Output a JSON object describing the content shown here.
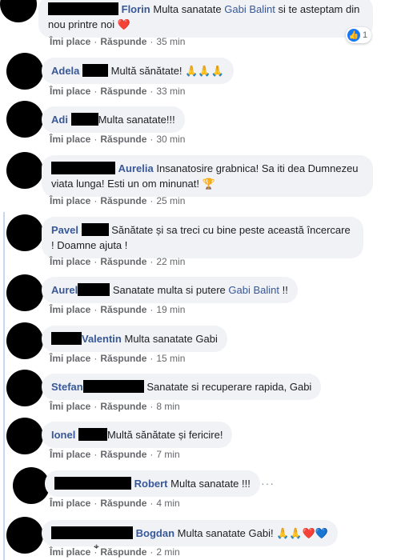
{
  "actions": {
    "like": "Îmi place",
    "reply": "Răspunde"
  },
  "comments": [
    {
      "author": "Florin",
      "text_before": "Multa sanatate ",
      "mention": "Gabi Balint",
      "text_after": " si te asteptam din nou printre noi",
      "emoji": "❤️",
      "time": "35 min",
      "reaction_count": "1"
    },
    {
      "author": "Adela",
      "text": "Multă sănătate! 🙏🙏🙏",
      "time": "33 min"
    },
    {
      "author": "Adi",
      "text": "Multa sanatate!!!",
      "time": "30 min"
    },
    {
      "author": "Aurelia",
      "text": "Insanatosire grabnica! Sa iti dea Dumnezeu viata lunga! Esti un om minunat! 🏆",
      "time": "25 min"
    },
    {
      "author": "Pavel",
      "text": "Sănătate și sa treci cu bine peste această încercare ! Doamne ajuta !",
      "time": "22 min"
    },
    {
      "author": "Aurel",
      "text_before": "Sanatate multa si putere ",
      "mention": "Gabi Balint",
      "text_after": " !!",
      "time": "19 min"
    },
    {
      "author": "Valentin",
      "text": "Multa sanatate Gabi",
      "time": "15 min"
    },
    {
      "author": "Stefan",
      "text": "Sanatate si recuperare rapida, Gabi",
      "time": "8 min"
    },
    {
      "author": "Ionel",
      "text": "Multă sănătate și fericire!",
      "time": "7 min"
    },
    {
      "author": "Robert",
      "text": "Multa sanatate !!!",
      "time": "4 min",
      "more": "···"
    },
    {
      "author": "Bogdan",
      "text": "Multa sanatate Gabi! 🙏🙏❤️💙",
      "time": "2 min"
    }
  ],
  "colors": {
    "author": "#385898",
    "bubble": "#f0f2f5",
    "meta": "#65676b",
    "like_blue": "#1877f2"
  }
}
